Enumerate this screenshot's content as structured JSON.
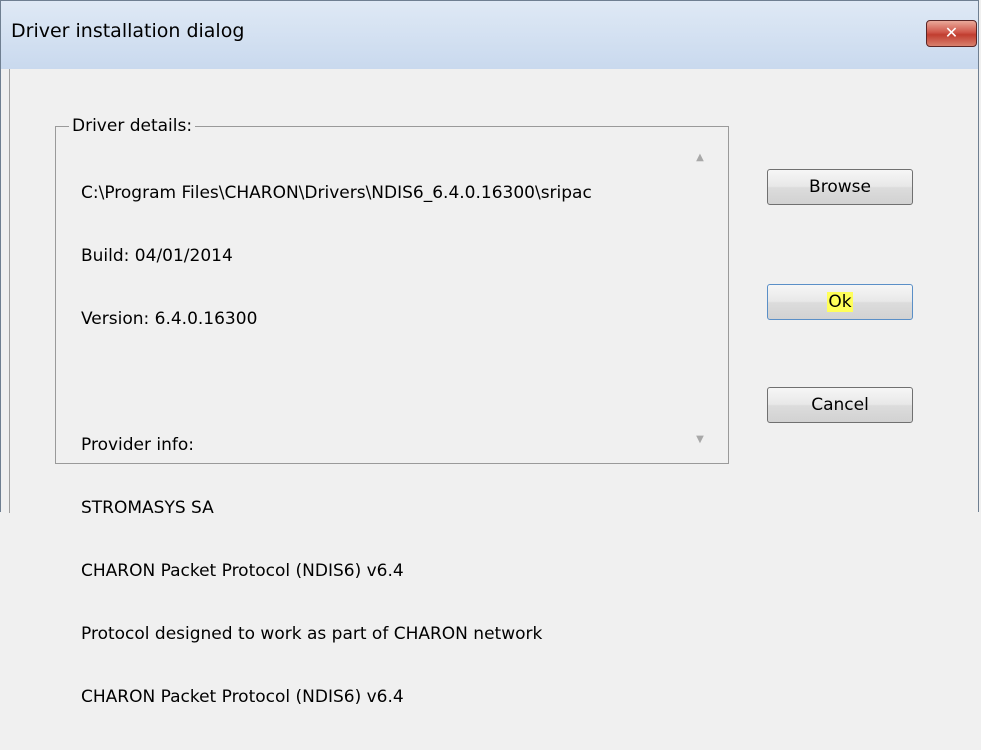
{
  "window": {
    "title": "Driver installation dialog",
    "close_label": "✕"
  },
  "group": {
    "label": "Driver details:",
    "lines": [
      "C:\\Program Files\\CHARON\\Drivers\\NDIS6_6.4.0.16300\\sripac",
      "Build: 04/01/2014",
      "Version: 6.4.0.16300",
      "",
      "Provider info:",
      "STROMASYS SA",
      "CHARON Packet Protocol (NDIS6) v6.4",
      "Protocol designed to work as part of CHARON network",
      "CHARON Packet Protocol (NDIS6) v6.4"
    ],
    "scroll_up": "▲",
    "scroll_down": "▼"
  },
  "buttons": {
    "browse": "Browse",
    "ok": "Ok",
    "cancel": "Cancel"
  }
}
